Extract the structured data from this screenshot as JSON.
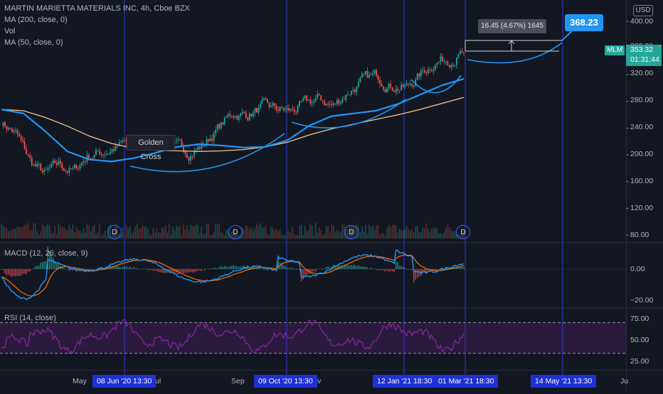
{
  "header": {
    "title": "MARTIN MARIETTA MATERIALS INC, 4h, Cboe BZX",
    "studies": [
      "MA (200, close, 0)",
      "Vol",
      "MA (50, close, 0)"
    ],
    "currency": "USD"
  },
  "price_pane": {
    "ticker": "MLM",
    "last_price": "353.32",
    "countdown": "01:31:44",
    "target_price": "368.23",
    "measure": "16.45 (4.67%) 1645",
    "annotation": "Golden Cross",
    "dividend_marker": "D"
  },
  "macd_pane": {
    "legend": "MACD (12, 26, close, 9)"
  },
  "rsi_pane": {
    "legend": "RSI (14, close)"
  },
  "time_axis": {
    "plain_labels": [
      "May",
      "ul",
      "Sep",
      "v",
      "Ju"
    ],
    "pills": [
      "08 Jun '20   13:30",
      "09 Oct '20   13:30",
      "12 Jan '21   18:30",
      "01 Mar '21   18:30",
      "14 May '21   13:30"
    ]
  },
  "colors": {
    "background": "#131722",
    "up": "#26a69a",
    "down": "#ef5350",
    "ma50": "#2196f3",
    "ma200": "#f7c58f",
    "macd": "#2196f3",
    "signal": "#ff6d00",
    "rsi": "#9c27b0",
    "vline": "#2b38d6"
  },
  "chart_data": [
    {
      "type": "line",
      "title": "MARTIN MARIETTA MATERIALS INC, 4h, Cboe BZX",
      "y_ticks": [
        "400.00",
        "360.00",
        "320.00",
        "280.00",
        "240.00",
        "200.00",
        "160.00",
        "120.00",
        "80.00"
      ],
      "ylim": [
        70,
        410
      ],
      "series": [
        {
          "name": "MA (50, close, 0)",
          "values": [
            268,
            262,
            235,
            205,
            193,
            190,
            195,
            203,
            212,
            216,
            214,
            211,
            212,
            222,
            244,
            258,
            262,
            266,
            276,
            290,
            304,
            314
          ]
        },
        {
          "name": "MA (200, close, 0)",
          "values": [
            268,
            266,
            256,
            243,
            228,
            217,
            210,
            207,
            206,
            205,
            206,
            208,
            212,
            219,
            230,
            239,
            246,
            253,
            260,
            268,
            277,
            286
          ]
        }
      ],
      "price_path": [
        250,
        232,
        190,
        170,
        185,
        175,
        200,
        204,
        212,
        220,
        218,
        225,
        210,
        205,
        215,
        240,
        262,
        260,
        270,
        268,
        265,
        275,
        283,
        273,
        295,
        310,
        318,
        305,
        300,
        320,
        340,
        345,
        352
      ],
      "last": 353.32,
      "target": 368.23
    },
    {
      "type": "line",
      "title": "MACD (12, 26, close, 9)",
      "y_ticks": [
        "0.00",
        "−20.00"
      ],
      "ylim": [
        -28,
        14
      ]
    },
    {
      "type": "line",
      "title": "RSI (14, close)",
      "y_ticks": [
        "75.00",
        "50.00",
        "25.00"
      ],
      "ylim": [
        15,
        85
      ],
      "bands": [
        30,
        70
      ]
    }
  ]
}
